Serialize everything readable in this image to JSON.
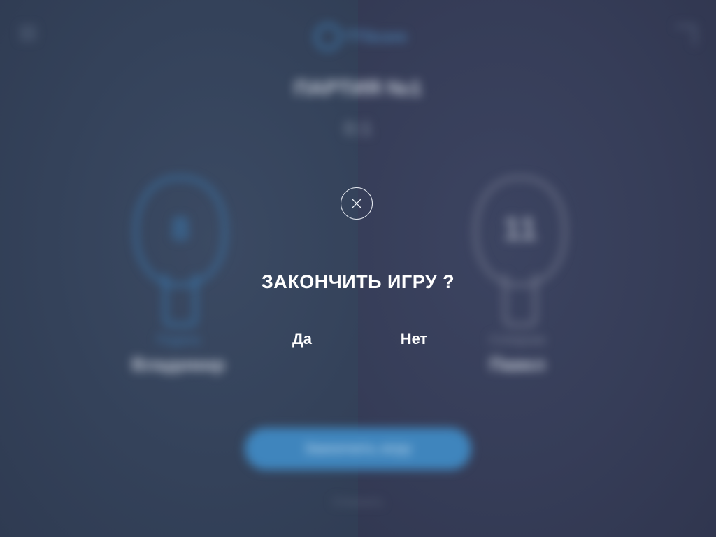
{
  "backdrop": {
    "logo_text": "TTScore",
    "game_title": "ПАРТИЯ №1",
    "game_score": "0:1",
    "left_player": {
      "score": "8",
      "role": "Подача",
      "name": "Владимир"
    },
    "right_player": {
      "score": "11",
      "role": "Соперник",
      "name": "Павел"
    },
    "main_button": "Закончить игру",
    "footer_link": "Отменить"
  },
  "dialog": {
    "title": "ЗАКОНЧИТЬ ИГРУ ?",
    "yes_label": "Да",
    "no_label": "Нет"
  },
  "colors": {
    "accent": "#3f85bd",
    "background": "#344157",
    "text": "#ffffff"
  },
  "icons": [
    "menu-icon",
    "share-icon",
    "close-icon"
  ]
}
